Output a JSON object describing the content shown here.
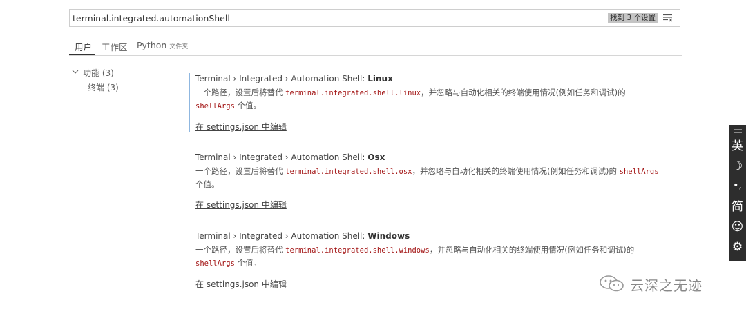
{
  "search": {
    "value": "terminal.integrated.automationShell",
    "result_count": "找到 3 个设置"
  },
  "tabs": [
    {
      "label": "用户",
      "active": true
    },
    {
      "label": "工作区"
    },
    {
      "label": "Python",
      "sub": "文件夹"
    }
  ],
  "tree": {
    "group": "功能",
    "group_count": "(3)",
    "child": "终端",
    "child_count": "(3)"
  },
  "settings": [
    {
      "title_prefix": "Terminal › Integrated › Automation Shell: ",
      "title_name": "Linux",
      "desc_before": "一个路径，设置后将替代 ",
      "desc_code": "terminal.integrated.shell.linux",
      "desc_after": "，并忽略与自动化相关的终端使用情况(例如任务和调试)的 ",
      "desc_code2": "shellArgs",
      "desc_end": " 个值。",
      "link": "在 settings.json 中编辑"
    },
    {
      "title_prefix": "Terminal › Integrated › Automation Shell: ",
      "title_name": "Osx",
      "desc_before": "一个路径，设置后将替代 ",
      "desc_code": "terminal.integrated.shell.osx",
      "desc_after": "，并忽略与自动化相关的终端使用情况(例如任务和调试)的 ",
      "desc_code2": "shellArgs",
      "desc_end": " 个值。",
      "link": "在 settings.json 中编辑"
    },
    {
      "title_prefix": "Terminal › Integrated › Automation Shell: ",
      "title_name": "Windows",
      "desc_before": "一个路径，设置后将替代 ",
      "desc_code": "terminal.integrated.shell.windows",
      "desc_after": "，并忽略与自动化相关的终端使用情况(例如任务和调试)的 ",
      "desc_code2": "shellArgs",
      "desc_end": " 个值。",
      "link": "在 settings.json 中编辑"
    }
  ],
  "ime": {
    "lang": "英",
    "moon": "☽",
    "punct": "•,",
    "simplified": "简",
    "emoji": "☺",
    "gear": "⚙"
  },
  "watermark": {
    "text": "云深之无迹",
    "icon": "wechat-icon"
  },
  "colors": {
    "accent_border": "#8fb7e0",
    "code": "#a31515"
  }
}
